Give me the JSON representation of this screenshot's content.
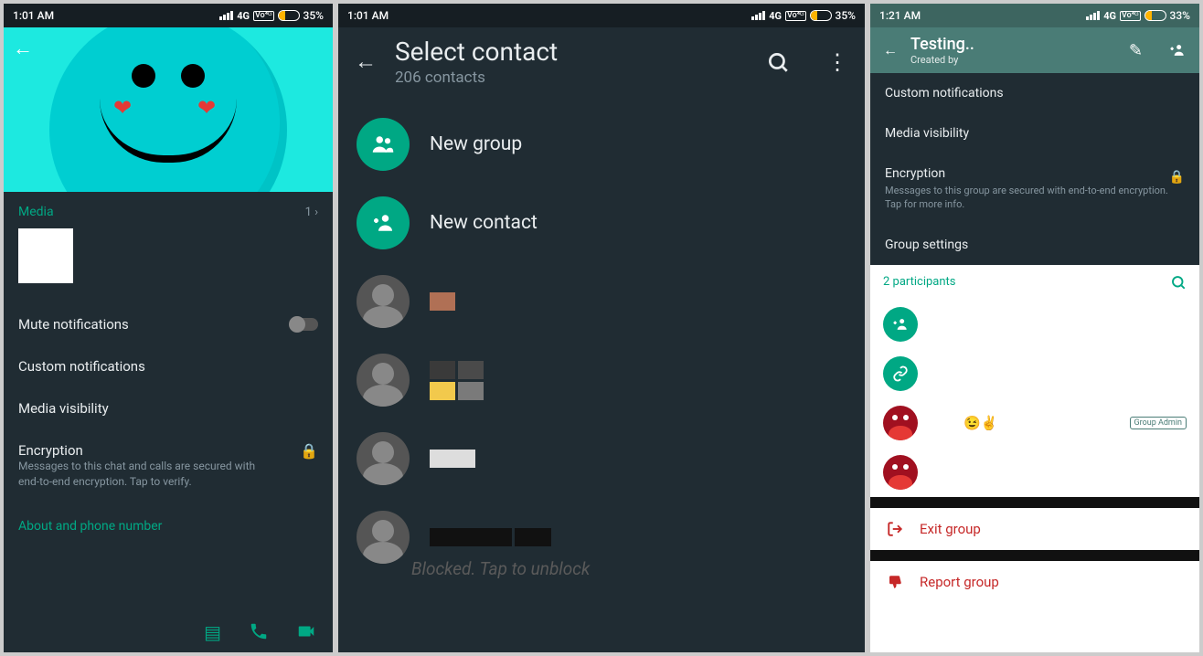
{
  "p1": {
    "status": {
      "time": "1:01 AM",
      "net": "4G",
      "volte": "Vo⁴ᴳ",
      "battery": "35%"
    },
    "media_label": "Media",
    "media_count": "1 ›",
    "settings": {
      "mute": "Mute notifications",
      "custom": "Custom notifications",
      "visibility": "Media visibility",
      "encryption_title": "Encryption",
      "encryption_sub": "Messages to this chat and calls are secured with end-to-end encryption. Tap to verify."
    },
    "about_link": "About and phone number"
  },
  "p2": {
    "status": {
      "time": "1:01 AM",
      "net": "4G",
      "volte": "Vo⁴ᴳ",
      "battery": "35%"
    },
    "title": "Select contact",
    "subtitle": "206 contacts",
    "new_group": "New group",
    "new_contact": "New contact",
    "blocked": "Blocked. Tap to unblock"
  },
  "p3": {
    "status": {
      "time": "1:21 AM",
      "net": "4G",
      "volte": "Vo⁴ᴳ",
      "battery": "33%"
    },
    "header": {
      "title": "Testing..",
      "subtitle": "Created by"
    },
    "settings": {
      "custom": "Custom notifications",
      "visibility": "Media visibility",
      "encryption_title": "Encryption",
      "encryption_sub": "Messages to this group are secured with end-to-end encryption. Tap for more info.",
      "group": "Group settings"
    },
    "participants_label": "2 participants",
    "admin_badge": "Group Admin",
    "emoji": "😉✌️",
    "exit": "Exit group",
    "report": "Report group"
  }
}
